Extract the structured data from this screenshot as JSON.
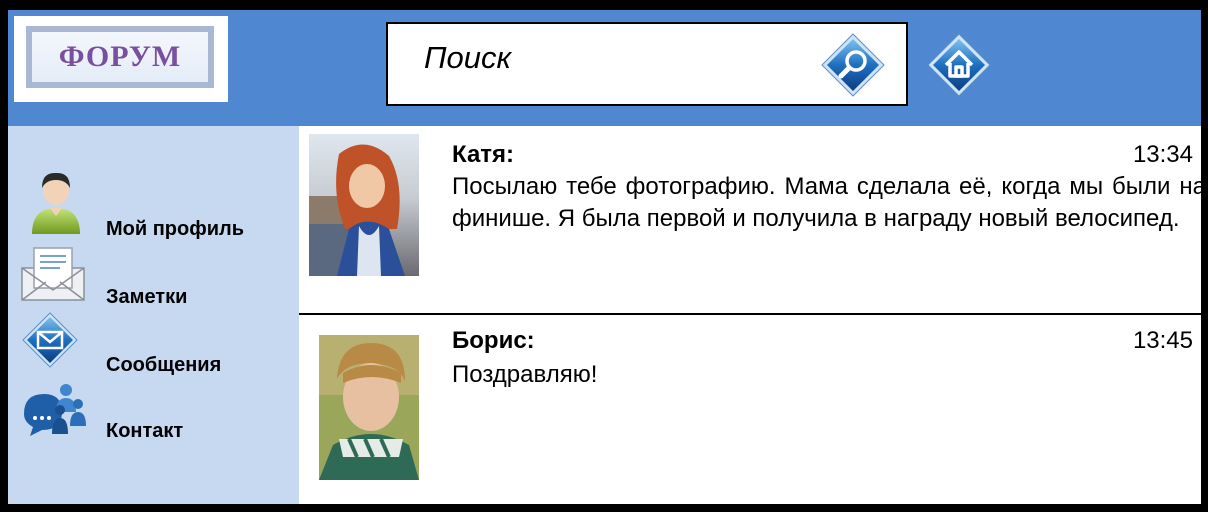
{
  "header": {
    "logo_text": "ФОРУМ",
    "search_placeholder": "Поиск",
    "search_button_icon": "magnifier-icon",
    "home_button_icon": "home-icon"
  },
  "sidebar": {
    "items": [
      {
        "label": "Мой профиль",
        "icon": "user-icon"
      },
      {
        "label": "Заметки",
        "icon": "envelope-letter-icon"
      },
      {
        "label": "Сообщения",
        "icon": "mail-diamond-icon"
      },
      {
        "label": "Контакт",
        "icon": "people-icon"
      }
    ]
  },
  "messages": [
    {
      "author": "Катя:",
      "time": "13:34",
      "text": "Посылаю тебе фотографию. Мама сделала её, когда мы были на финише. Я была первой и получила в награду новый велосипед."
    },
    {
      "author": "Борис:",
      "time": "13:45",
      "text": "Поздравляю!"
    }
  ],
  "colors": {
    "header_bg": "#4f87d0",
    "sidebar_bg": "#c6d9f1",
    "frame": "#000000"
  }
}
